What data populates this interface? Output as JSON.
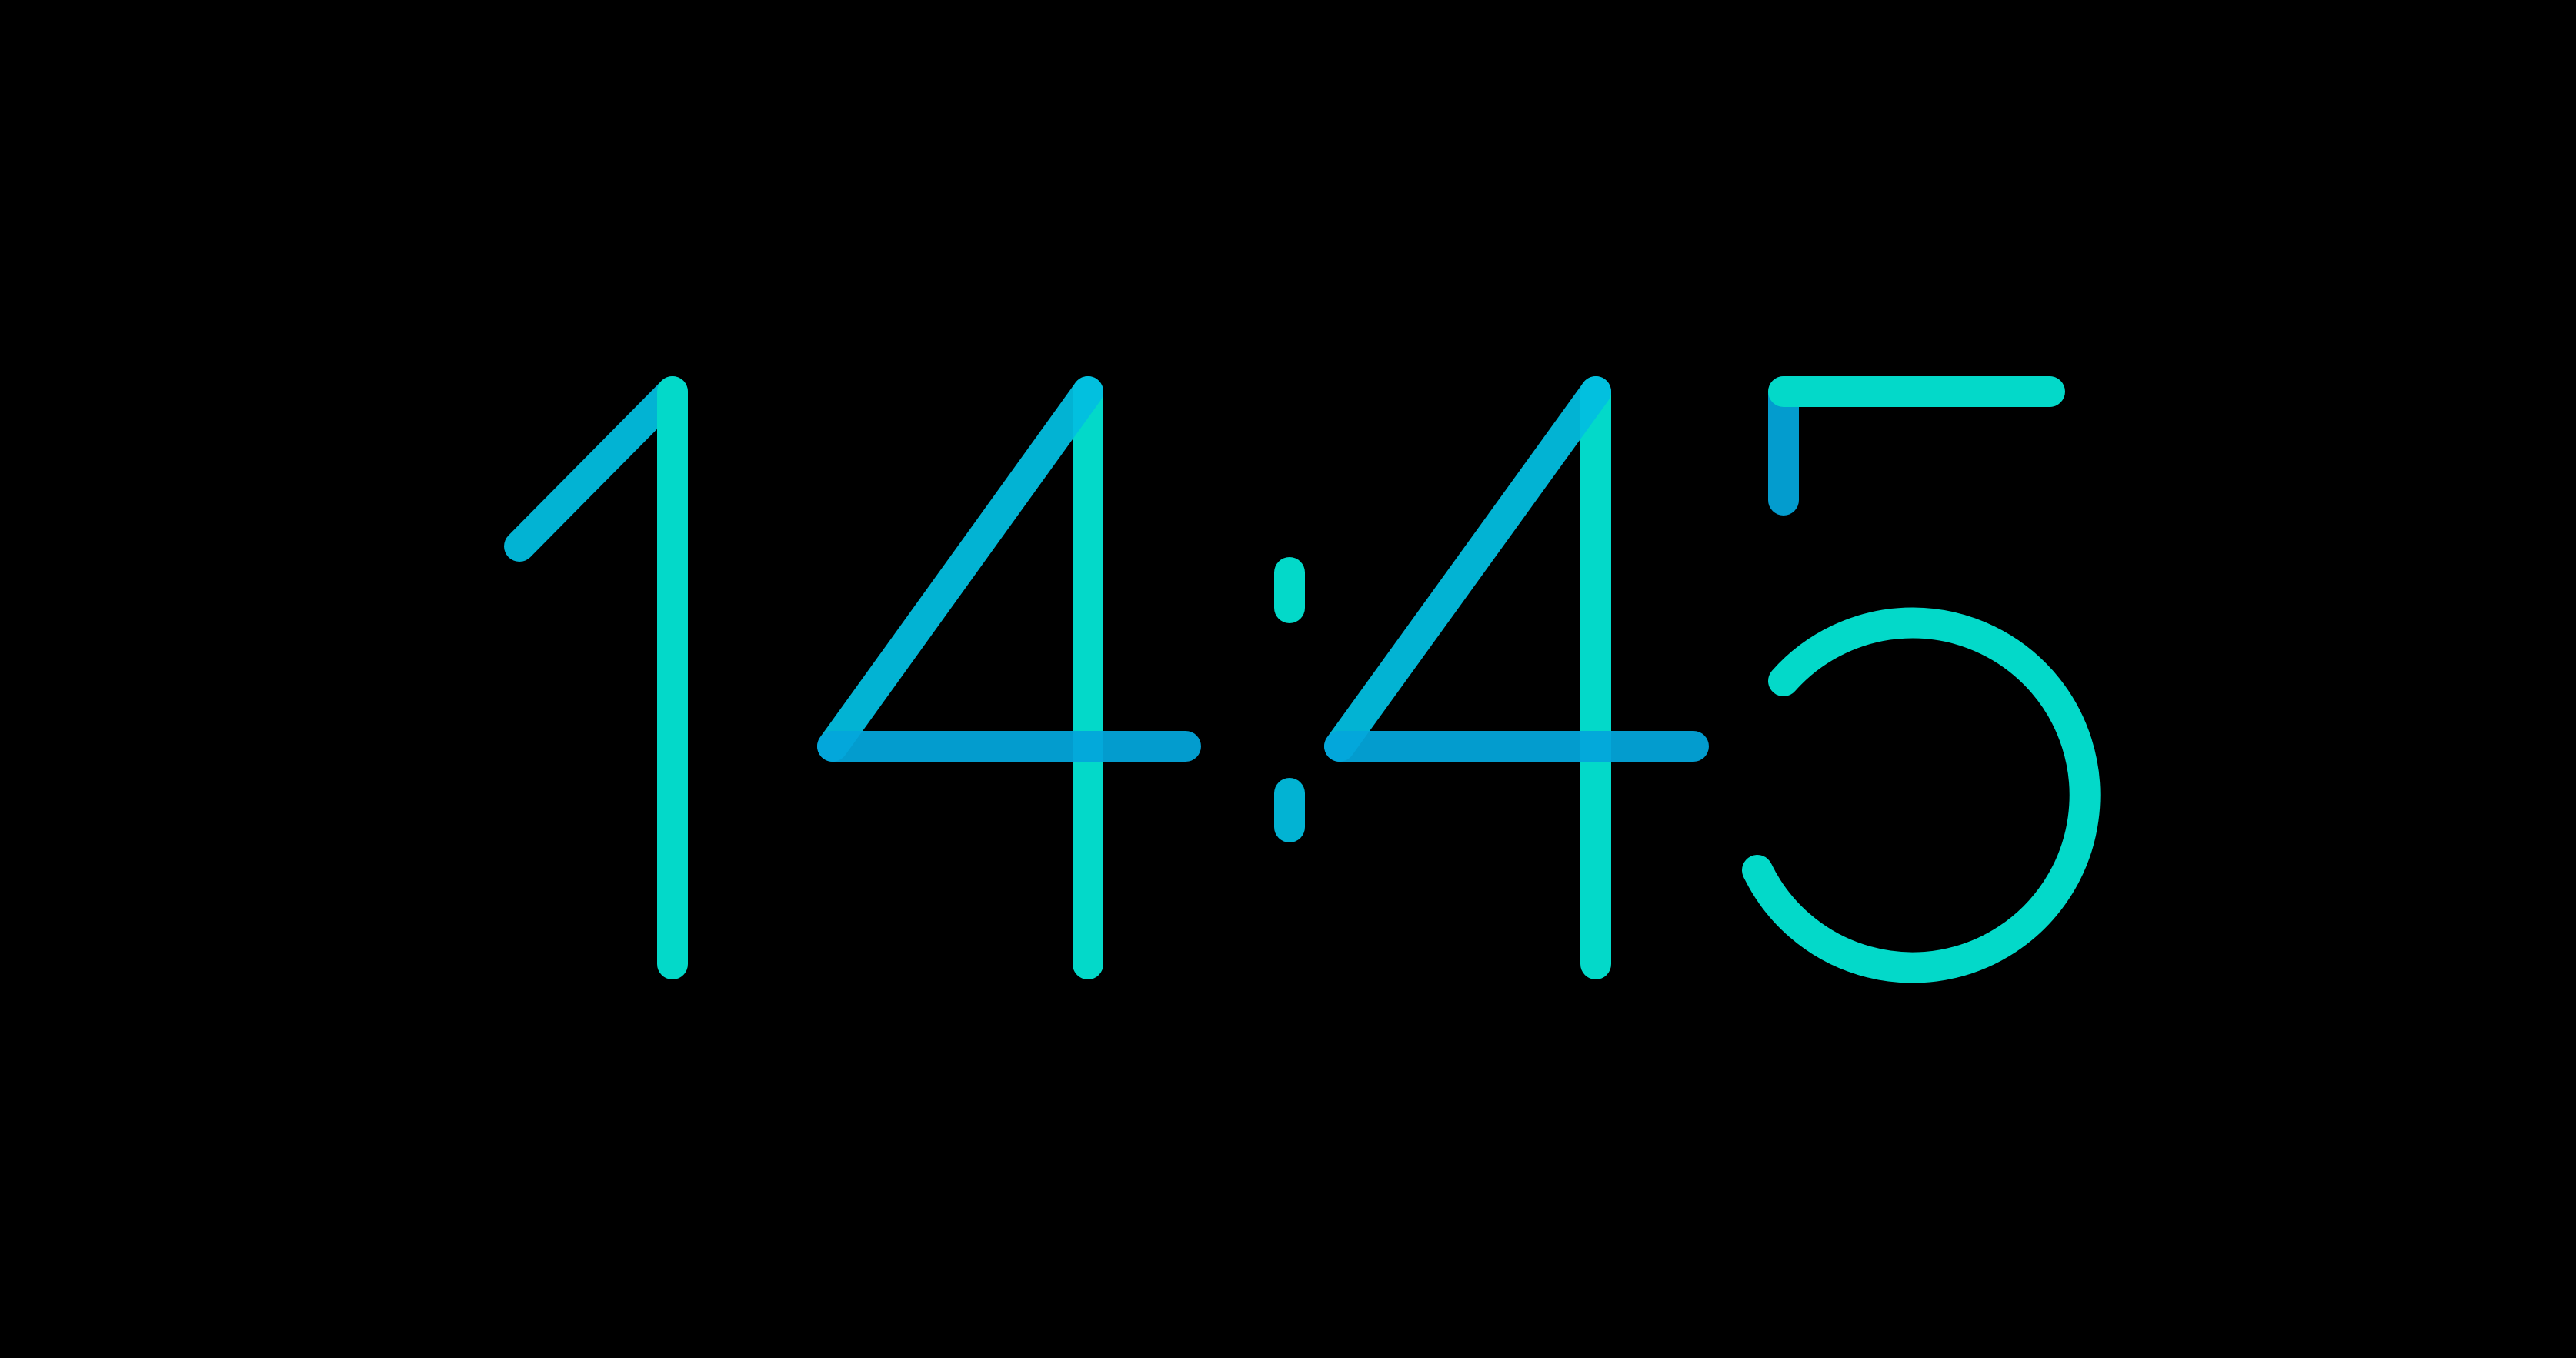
{
  "clock": {
    "time": "14:45",
    "hours": "14",
    "minutes": "45",
    "separator": ":",
    "digits": [
      "1",
      "4",
      "4",
      "5"
    ]
  },
  "colors": {
    "background": "#000000",
    "teal": "#03d9c9",
    "cyan": "#02bee0",
    "blue": "#03a6db"
  }
}
